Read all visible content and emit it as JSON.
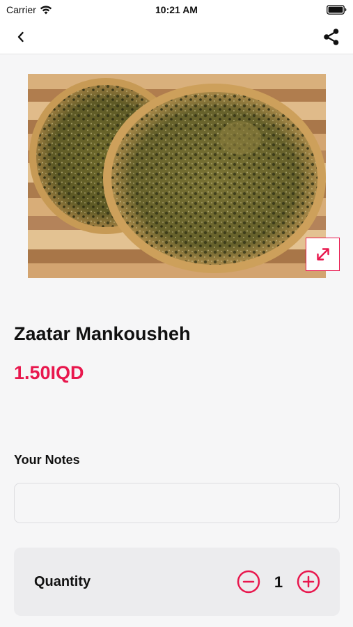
{
  "status_bar": {
    "carrier": "Carrier",
    "time": "10:21 AM",
    "wifi_icon": "wifi-icon",
    "battery_icon": "battery-icon"
  },
  "nav": {
    "back_icon": "chevron-left-icon",
    "share_icon": "share-icon"
  },
  "product": {
    "image_alt": "zaatar-flatbread-photo",
    "name": "Zaatar Mankousheh",
    "price": "1.50IQD",
    "expand_icon": "expand-arrows-icon"
  },
  "notes": {
    "label": "Your Notes",
    "value": "",
    "placeholder": ""
  },
  "quantity": {
    "label": "Quantity",
    "value": "1",
    "minus_icon": "minus-circle-icon",
    "plus_icon": "plus-circle-icon"
  },
  "colors": {
    "accent": "#e8174d",
    "background": "#f6f6f7",
    "card": "#ececee",
    "text": "#111111"
  }
}
